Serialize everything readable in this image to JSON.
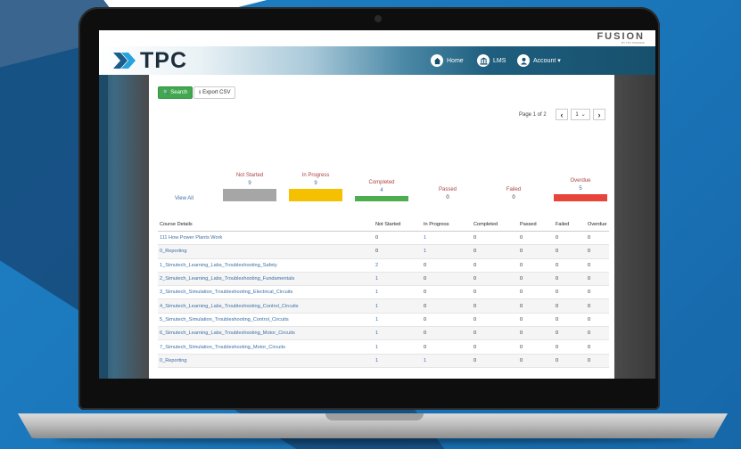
{
  "app": {
    "brand": "TPC",
    "partner_logo": "FUSION",
    "partner_logo_sub": "BY TPC TRAINING"
  },
  "nav": {
    "home": {
      "label": "Home",
      "icon": "home-icon"
    },
    "lms": {
      "label": "LMS",
      "icon": "institution-icon"
    },
    "account": {
      "label": "Account",
      "icon": "user-icon",
      "caret": "▾"
    }
  },
  "toolbar": {
    "search_label": "Search",
    "export_label": "Export CSV",
    "search_icon": "🔍",
    "export_icon": "⭳"
  },
  "pager": {
    "text": "Page 1 of 2",
    "prev": "‹",
    "page": "1",
    "page_caret": "⌄",
    "next": "›"
  },
  "summary": {
    "view_all": "View All",
    "items": [
      {
        "label": "Not Started",
        "value": "9",
        "color": "#a6a6a6"
      },
      {
        "label": "In Progress",
        "value": "9",
        "color": "#f5c000"
      },
      {
        "label": "Completed",
        "value": "4",
        "color": "#4cae4f"
      },
      {
        "label": "Passed",
        "value": "0",
        "color": ""
      },
      {
        "label": "Failed",
        "value": "0",
        "color": ""
      },
      {
        "label": "Overdue",
        "value": "5",
        "color": "#e8443a"
      }
    ]
  },
  "table": {
    "headers": [
      "Course Details",
      "Not Started",
      "In Progress",
      "Completed",
      "Passed",
      "Failed",
      "Overdue"
    ],
    "rows": [
      [
        "111 How Power Plants Work",
        "0",
        "1",
        "0",
        "0",
        "0",
        "0"
      ],
      [
        "0_Reporting",
        "0",
        "1",
        "0",
        "0",
        "0",
        "0"
      ],
      [
        "1_Simutech_Learning_Labs_Troubleshooting_Safety",
        "2",
        "0",
        "0",
        "0",
        "0",
        "0"
      ],
      [
        "2_Simutech_Learning_Labs_Troubleshooting_Fundamentals",
        "1",
        "0",
        "0",
        "0",
        "0",
        "0"
      ],
      [
        "3_Simutech_Simulation_Troubleshooting_Electrical_Circuits",
        "1",
        "0",
        "0",
        "0",
        "0",
        "0"
      ],
      [
        "4_Simutech_Learning_Labs_Troubleshooting_Control_Circuits",
        "1",
        "0",
        "0",
        "0",
        "0",
        "0"
      ],
      [
        "5_Simutech_Simulation_Troubleshooting_Control_Circuits",
        "1",
        "0",
        "0",
        "0",
        "0",
        "0"
      ],
      [
        "6_Simutech_Learning_Labs_Troubleshooting_Motor_Circuits",
        "1",
        "0",
        "0",
        "0",
        "0",
        "0"
      ],
      [
        "7_Simutech_Simulation_Troubleshooting_Motor_Circuits",
        "1",
        "0",
        "0",
        "0",
        "0",
        "0"
      ],
      [
        "0_Reporting",
        "1",
        "1",
        "0",
        "0",
        "0",
        "0"
      ]
    ]
  }
}
